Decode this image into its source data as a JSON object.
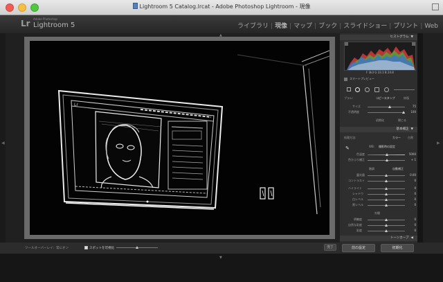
{
  "window": {
    "title": "Lightroom 5 Catalog.lrcat - Adobe Photoshop Lightroom - 現像"
  },
  "brand": {
    "logo": "Lr",
    "sub": "Adobe Photoshop",
    "name": "Lightroom 5"
  },
  "modules": [
    {
      "label": "ライブラリ",
      "active": false
    },
    {
      "label": "現像",
      "active": true
    },
    {
      "label": "マップ",
      "active": false
    },
    {
      "label": "ブック",
      "active": false
    },
    {
      "label": "スライドショー",
      "active": false
    },
    {
      "label": "プリント",
      "active": false
    },
    {
      "label": "Web",
      "active": false
    }
  ],
  "panel": {
    "histogram_label": "ヒストグラム",
    "histogram_info": "F 3k3   G 33.1   B 24.8",
    "smart_preview_label": "スマートプレビュー",
    "brush_label": "ブラシ:",
    "copy_stamp": "コピースタンプ",
    "heal": "修復",
    "size_label": "サイズ",
    "size_value": "75",
    "opacity_label": "不透明度",
    "opacity_value": "100",
    "reset_label": "初期化",
    "close_label": "閉じる",
    "basic_label": "基本補正",
    "treatment_label": "処理方法:",
    "color_label": "カラー",
    "bw_label": "白黒",
    "wb_label": "WB:",
    "wb_value": "撮影時の設定",
    "temp_label": "色温度",
    "temp_value": "5000",
    "tint_label": "色かぶり補正",
    "tint_value": "+ 1",
    "tone_label": "階調",
    "auto_label": "自動補正",
    "exposure_label": "露光量",
    "exposure_value": "0.00",
    "contrast_label": "コントラスト",
    "contrast_value": "0",
    "highlights_label": "ハイライト",
    "highlights_value": "0",
    "shadows_label": "シャドウ",
    "shadows_value": "0",
    "whites_label": "白レベル",
    "whites_value": "0",
    "blacks_label": "黒レベル",
    "blacks_value": "0",
    "presence_label": "外観",
    "clarity_label": "明瞭度",
    "clarity_value": "0",
    "vibrance_label": "自然な彩度",
    "vibrance_value": "0",
    "saturation_label": "彩度",
    "saturation_value": "0",
    "tone_curve_label": "トーンカーブ",
    "prev_button": "前の設定",
    "reset_button": "初期化"
  },
  "toolbar": {
    "label": "ツールオーバーレイ：常にオン",
    "spot_label": "スポットを可視化",
    "done_label": "完了"
  }
}
